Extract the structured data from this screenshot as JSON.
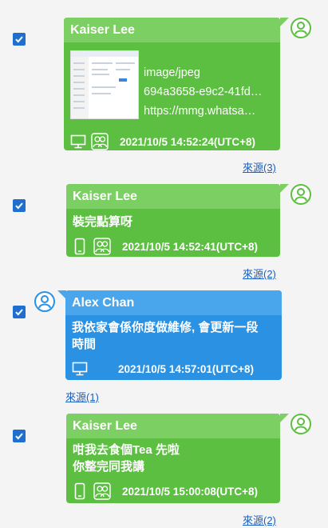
{
  "messages": [
    {
      "sender": "Kaiser Lee",
      "attachment": {
        "type": "image/jpeg",
        "name": "694a3658-e9c2-41fd…",
        "url": "https://mmg.whatsa…"
      },
      "device": "desktop",
      "timestamp": "2021/10/5 14:52:24(UTC+8)",
      "source": "來源(3)",
      "checked": true
    },
    {
      "sender": "Kaiser Lee",
      "text": "裝完點算呀",
      "device": "mobile",
      "timestamp": "2021/10/5 14:52:41(UTC+8)",
      "source": "來源(2)",
      "checked": true
    },
    {
      "sender": "Alex Chan",
      "text_line1": "我依家會係你度做維修, 會更新一段",
      "text_line2": "時間",
      "device": "desktop",
      "timestamp": "2021/10/5 14:57:01(UTC+8)",
      "source": "來源(1)",
      "checked": true
    },
    {
      "sender": "Kaiser Lee",
      "text_line1": "咁我去食個Tea 先啦",
      "text_line2": "你整完同我講",
      "device": "mobile",
      "timestamp": "2021/10/5 15:00:08(UTC+8)",
      "source": "來源(2)",
      "checked": true
    }
  ],
  "colors": {
    "outgoing_bubble": "#5cbf41",
    "incoming_bubble": "#2a91e3",
    "checkbox": "#1f6fd1",
    "link": "#1f5fbf"
  }
}
